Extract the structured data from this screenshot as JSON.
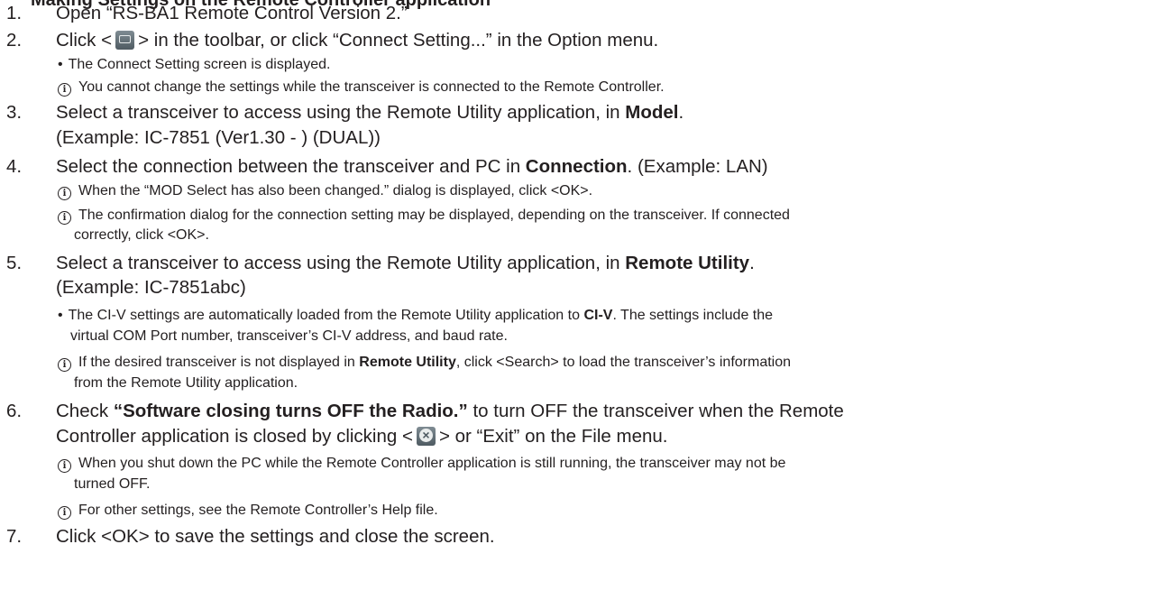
{
  "header_fragment": "Making Settings on the Remote Controller application",
  "steps": [
    {
      "num": "1.",
      "text": "Open “RS-BA1 Remote Control Version 2.”"
    },
    {
      "num": "2.",
      "pre": "Click <",
      "icon": "connect-setting-toolbar-icon",
      "post": "> in the toolbar, or click “Connect Setting...” in the Option menu.",
      "bullet": "The Connect Setting screen is displayed.",
      "info": "You cannot change the settings while the transceiver is connected to the Remote Controller."
    },
    {
      "num": "3.",
      "pre": "Select a transceiver to access using the Remote Utility application, in ",
      "bold": "Model",
      "post": ".",
      "line2": "(Example: IC-7851 (Ver1.30 - ) (DUAL))"
    },
    {
      "num": "4.",
      "pre": "Select the connection between the transceiver and PC in ",
      "bold": "Connection",
      "post": ". (Example: LAN)",
      "info1": "When the “MOD Select has also been changed.” dialog is displayed, click <OK>.",
      "info2a": "The confirmation dialog for the connection setting may be displayed, depending on the transceiver. If connected",
      "info2b": "correctly, click <OK>."
    },
    {
      "num": "5.",
      "pre": "Select a transceiver to access using the Remote Utility application, in ",
      "bold": "Remote Utility",
      "post": ".",
      "line2": "(Example: IC-7851abc)",
      "bullet_a_pre": "The CI-V settings are automatically loaded from the Remote Utility application to ",
      "bullet_a_bold": "CI-V",
      "bullet_a_post": ". The settings include the",
      "bullet_b": "virtual COM Port number, transceiver’s CI-V address, and baud rate.",
      "info_pre": "If the desired transceiver is not displayed in ",
      "info_bold": "Remote Utility",
      "info_post": ", click <Search> to load the transceiver’s information",
      "info_cont": "from the Remote Utility application."
    },
    {
      "num": "6.",
      "pre": "Check ",
      "bold": "“Software closing turns OFF the Radio.”",
      "post": " to turn OFF the transceiver when the Remote",
      "line2_pre": "Controller application is closed by clicking <",
      "icon": "exit-toolbar-icon",
      "line2_post": "> or “Exit” on the File menu.",
      "info1a": "When you shut down the PC while the Remote Controller application is still running, the transceiver may not be",
      "info1b": "turned OFF.",
      "info2": "For other settings, see the Remote Controller’s Help file."
    },
    {
      "num": "7.",
      "text": "Click <OK> to save the settings and close the screen."
    }
  ]
}
